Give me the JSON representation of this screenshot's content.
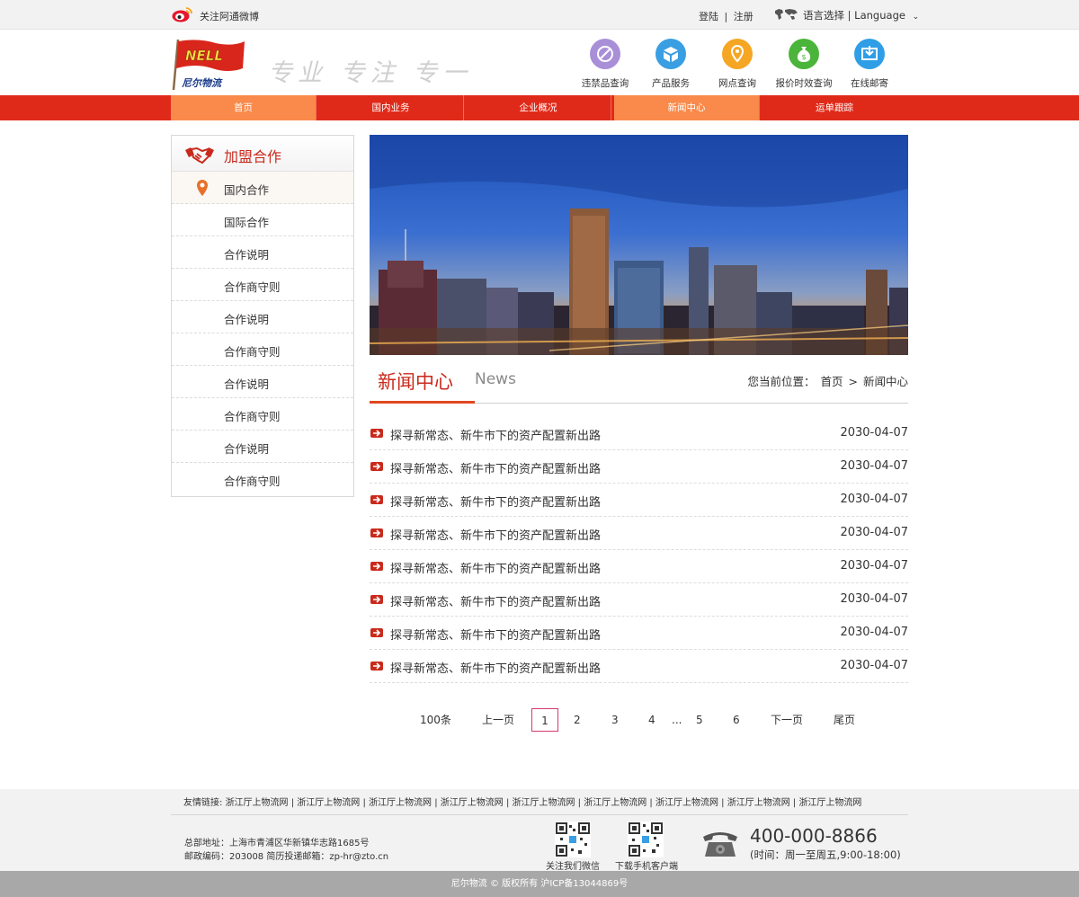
{
  "topbar": {
    "weibo_text": "关注阿通微博",
    "login": "登陆",
    "sep": "|",
    "register": "注册",
    "language": "语言选择 | Language"
  },
  "header": {
    "logo_text": "NELL",
    "logo_cn": "尼尔物流",
    "slogan": "专业 专注 专一",
    "quick_links": [
      {
        "label": "违禁品查询",
        "icon": "forbidden-icon",
        "color": "#a88fd8"
      },
      {
        "label": "产品服务",
        "icon": "box-icon",
        "color": "#3a9ee2"
      },
      {
        "label": "网点查询",
        "icon": "location-icon",
        "color": "#f5a623"
      },
      {
        "label": "报价时效查询",
        "icon": "money-bag-icon",
        "color": "#4bb43a"
      },
      {
        "label": "在线邮寄",
        "icon": "download-box-icon",
        "color": "#2f9ee6"
      }
    ]
  },
  "nav": {
    "items": [
      {
        "label": "首页"
      },
      {
        "label": "国内业务"
      },
      {
        "label": "企业概况"
      },
      {
        "label": "新闻中心"
      },
      {
        "label": "运单跟踪"
      }
    ]
  },
  "sidebar": {
    "title": "加盟合作",
    "items": [
      {
        "label": "国内合作"
      },
      {
        "label": "国际合作"
      },
      {
        "label": "合作说明"
      },
      {
        "label": "合作商守则"
      },
      {
        "label": "合作说明"
      },
      {
        "label": "合作商守则"
      },
      {
        "label": "合作说明"
      },
      {
        "label": "合作商守则"
      },
      {
        "label": "合作说明"
      },
      {
        "label": "合作商守则"
      }
    ]
  },
  "news": {
    "title_cn": "新闻中心",
    "title_en": "News",
    "breadcrumb_prefix": "您当前位置：",
    "breadcrumb_home": "首页",
    "breadcrumb_sep": ">",
    "breadcrumb_current": "新闻中心",
    "items": [
      {
        "title": "探寻新常态、新牛市下的资产配置新出路",
        "date": "2030-04-07"
      },
      {
        "title": "探寻新常态、新牛市下的资产配置新出路",
        "date": "2030-04-07"
      },
      {
        "title": "探寻新常态、新牛市下的资产配置新出路",
        "date": "2030-04-07"
      },
      {
        "title": "探寻新常态、新牛市下的资产配置新出路",
        "date": "2030-04-07"
      },
      {
        "title": "探寻新常态、新牛市下的资产配置新出路",
        "date": "2030-04-07"
      },
      {
        "title": "探寻新常态、新牛市下的资产配置新出路",
        "date": "2030-04-07"
      },
      {
        "title": "探寻新常态、新牛市下的资产配置新出路",
        "date": "2030-04-07"
      },
      {
        "title": "探寻新常态、新牛市下的资产配置新出路",
        "date": "2030-04-07"
      }
    ]
  },
  "pager": {
    "total": "100条",
    "prev": "上一页",
    "pages": [
      "1",
      "2",
      "3",
      "4"
    ],
    "ellipsis": "...",
    "more_pages": [
      "5",
      "6"
    ],
    "next": "下一页",
    "last": "尾页",
    "current": "1"
  },
  "footer": {
    "links_label": "友情链接:",
    "links": [
      "浙江厅上物流网",
      "浙江厅上物流网",
      "浙江厅上物流网",
      "浙江厅上物流网",
      "浙江厅上物流网",
      "浙江厅上物流网",
      "浙江厅上物流网",
      "浙江厅上物流网",
      "浙江厅上物流网"
    ],
    "address": "总部地址：上海市青浦区华新镇华志路1685号",
    "postcode": "邮政编码：203008 简历投递邮箱：zp-hr@zto.cn",
    "qr1_label": "关注我们微信",
    "qr2_label": "下载手机客户端",
    "phone": "400-000-8866",
    "hours": "(时间：周一至周五,9:00-18:00)",
    "copyright": "尼尔物流 © 版权所有 沪ICP备13044869号"
  }
}
